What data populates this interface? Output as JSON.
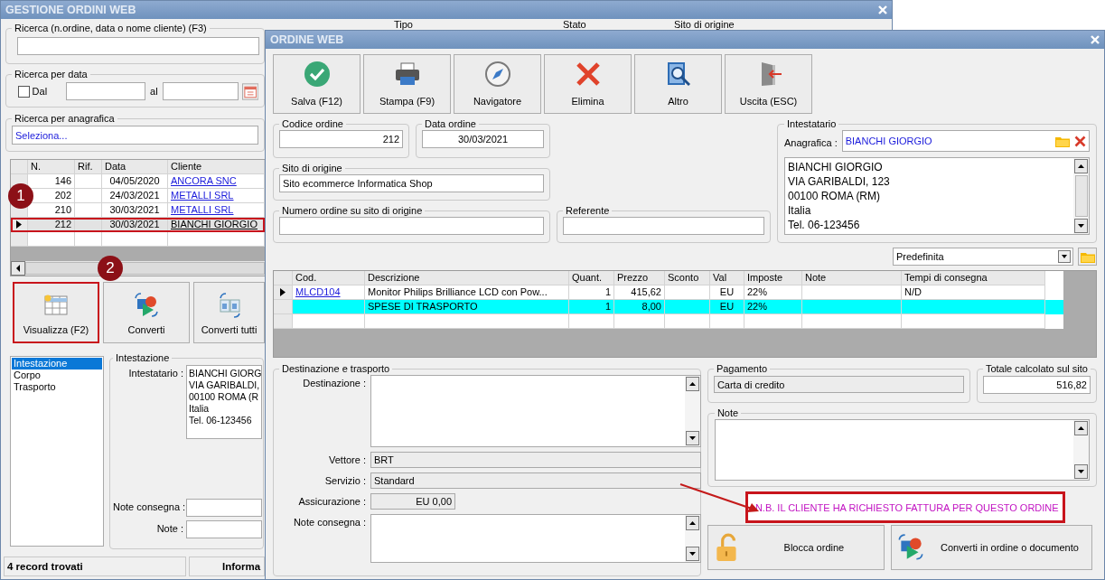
{
  "back_window": {
    "title": "GESTIONE ORDINI WEB",
    "top_filters": [
      "Tipo",
      "Stato",
      "Sito di origine"
    ],
    "search": {
      "label": "Ricerca (n.ordine, data o nome cliente) (F3)"
    },
    "date_search": {
      "label": "Ricerca per data",
      "from_label": "Dal",
      "from_checked": false,
      "to_label": "al"
    },
    "registry_search": {
      "label": "Ricerca per anagrafica",
      "value": "Seleziona..."
    },
    "orders_table": {
      "columns": [
        "N.",
        "Rif.",
        "Data",
        "Cliente"
      ],
      "rows": [
        {
          "number": "146",
          "date": "04/05/2020",
          "customer": "ANCORA SNC",
          "selected": false,
          "marked": false
        },
        {
          "number": "202",
          "date": "24/03/2021",
          "customer": "METALLI SRL",
          "selected": false,
          "marked": false
        },
        {
          "number": "210",
          "date": "30/03/2021",
          "customer": "METALLI SRL",
          "selected": false,
          "marked": false
        },
        {
          "number": "212",
          "date": "30/03/2021",
          "customer": "BIANCHI GIORGIO",
          "selected": true,
          "marked": true
        }
      ]
    },
    "callouts": [
      "1",
      "2"
    ],
    "actions": [
      {
        "label": "Visualizza (F2)",
        "kind": "view",
        "marked": true
      },
      {
        "label": "Converti",
        "kind": "convert",
        "marked": false
      },
      {
        "label": "Converti tutti",
        "kind": "convert_all",
        "marked": false
      }
    ],
    "sections": [
      {
        "label": "Intestazione",
        "selected": true
      },
      {
        "label": "Corpo",
        "selected": false
      },
      {
        "label": "Trasporto",
        "selected": false
      }
    ],
    "header_panel": {
      "title": "Intestazione",
      "holder_label": "Intestatario :",
      "holder_lines": [
        "BIANCHI GIORG",
        "VIA GARIBALDI,",
        "00100 ROMA (R",
        "Italia",
        "Tel. 06-123456"
      ],
      "delivery_note_label": "Note consegna :",
      "note_label": "Note :"
    },
    "status_bar": [
      "4 record trovati",
      "Informa"
    ]
  },
  "order_window": {
    "title": "ORDINE WEB",
    "toolbar": [
      {
        "label": "Salva (F12)",
        "kind": "save"
      },
      {
        "label": "Stampa (F9)",
        "kind": "print"
      },
      {
        "label": "Navigatore",
        "kind": "navigator"
      },
      {
        "label": "Elimina",
        "kind": "delete"
      },
      {
        "label": "Altro",
        "kind": "other"
      },
      {
        "label": "Uscita (ESC)",
        "kind": "exit"
      }
    ],
    "order_code": {
      "label": "Codice ordine",
      "value": "212"
    },
    "order_date": {
      "label": "Data ordine",
      "value": "30/03/2021"
    },
    "origin_site": {
      "label": "Sito di origine",
      "value": "Sito ecommerce Informatica Shop"
    },
    "site_order_number": {
      "label": "Numero ordine su sito di origine"
    },
    "contact": {
      "label": "Referente"
    },
    "holder": {
      "title": "Intestatario",
      "label": "Anagrafica :",
      "value": "BIANCHI GIORGIO",
      "address_lines": [
        "BIANCHI GIORGIO",
        "VIA GARIBALDI, 123",
        "00100 ROMA (RM)",
        "Italia",
        "Tel. 06-123456"
      ]
    },
    "layout_select": {
      "value": "Predefinita"
    },
    "lines_table": {
      "columns": [
        "Cod.",
        "Descrizione",
        "Quant.",
        "Prezzo",
        "Sconto",
        "Val",
        "Imposte",
        "Note",
        "Tempi di consegna"
      ],
      "rows": [
        {
          "code": "MLCD104",
          "description": "Monitor Philips Brilliance LCD con Pow...",
          "quantity": "1",
          "price": "415,62",
          "currency": "EU",
          "tax": "22%",
          "delivery_time": "N/D",
          "selected": true,
          "highlighted": false
        },
        {
          "description": "SPESE DI TRASPORTO",
          "quantity": "1",
          "price": "8,00",
          "currency": "EU",
          "tax": "22%",
          "selected": false,
          "highlighted": true
        }
      ]
    },
    "transport": {
      "title": "Destinazione e trasporto",
      "fields": [
        {
          "label": "Destinazione :",
          "kind": "memo"
        },
        {
          "label": "Vettore :",
          "kind": "readonly",
          "value": "BRT"
        },
        {
          "label": "Servizio :",
          "kind": "readonly",
          "value": "Standard"
        },
        {
          "label": "Assicurazione :",
          "kind": "amount",
          "value": "EU 0,00"
        },
        {
          "label": "Note consegna :",
          "kind": "memo"
        }
      ]
    },
    "payment": {
      "title": "Pagamento",
      "value": "Carta di credito"
    },
    "site_total": {
      "title": "Totale calcolato sul sito",
      "value": "516,82"
    },
    "notes": {
      "title": "Note"
    },
    "alert": "N.B. IL CLIENTE HA RICHIESTO FATTURA PER QUESTO ORDINE",
    "actions": [
      {
        "label": "Blocca ordine",
        "kind": "lock"
      },
      {
        "label": "Converti in ordine o documento",
        "kind": "convert"
      }
    ]
  }
}
